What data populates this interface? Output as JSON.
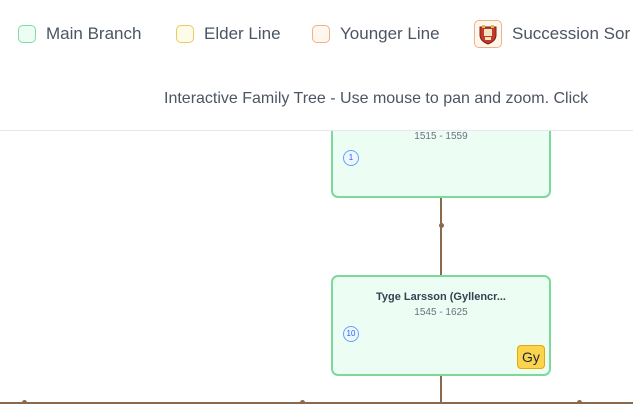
{
  "legend": {
    "items": [
      {
        "label": "Main Branch"
      },
      {
        "label": "Elder Line"
      },
      {
        "label": "Younger Line"
      },
      {
        "label": "Succession Sor"
      }
    ]
  },
  "instructions": "Interactive Family Tree - Use mouse to pan and zoom. Click",
  "nodes": [
    {
      "name": "",
      "dates": "1515 - 1559",
      "generation": "1"
    },
    {
      "name": "Tyge Larsson (Gyllencr...",
      "dates": "1545 - 1625",
      "generation": "10",
      "house_badge": "Gy"
    }
  ],
  "colors": {
    "main_branch": "#ecfdf3",
    "elder_line": "#fefce8",
    "younger_line": "#fff7ed",
    "connector": "#8a6a4e",
    "house_badge": "#fbd34d"
  }
}
